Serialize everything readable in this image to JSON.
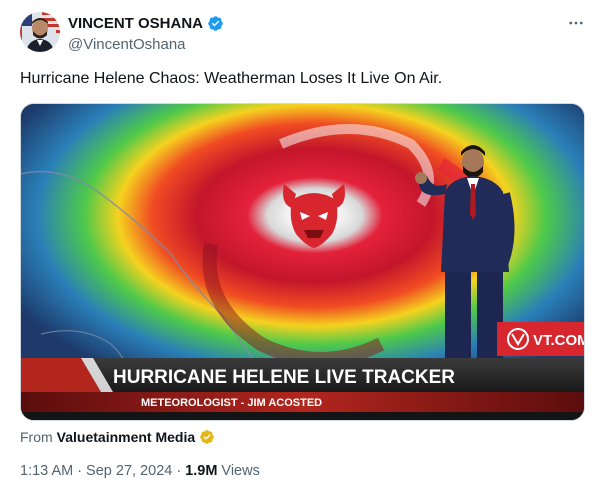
{
  "author": {
    "name": "VINCENT OSHANA",
    "handle": "@VincentOshana"
  },
  "tweet": {
    "text": "Hurricane Helene Chaos: Weatherman Loses It Live On Air."
  },
  "media": {
    "lower_third_title": "HURRICANE HELENE LIVE TRACKER",
    "lower_third_subtitle": "METEOROLOGIST - JIM ACOSTED",
    "logo_text": "VT.COM"
  },
  "source": {
    "prefix": "From",
    "name": "Valuetainment Media"
  },
  "meta": {
    "time": "1:13 AM",
    "separator1": "·",
    "date": "Sep 27, 2024",
    "separator2": "·",
    "views_count": "1.9M",
    "views_label": "Views"
  },
  "colors": {
    "verified_blue": "#1d9bf0",
    "gold_badge": "#e2b719",
    "brand_red": "#d7262e"
  },
  "icons": {
    "verified": "verified-badge-icon",
    "more": "more-options-icon",
    "gold": "gold-check-badge-icon"
  }
}
